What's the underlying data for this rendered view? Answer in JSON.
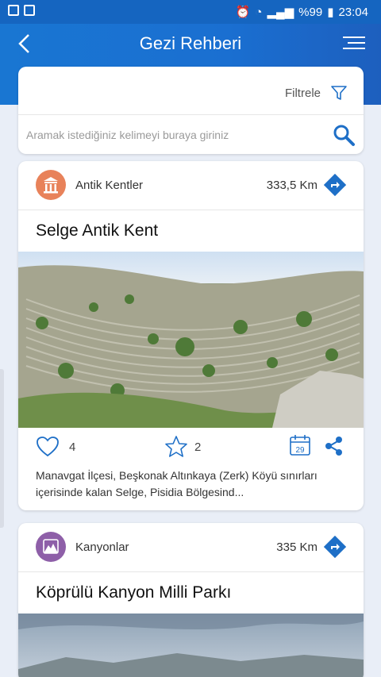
{
  "status_bar": {
    "battery": "%99",
    "time": "23:04"
  },
  "app_bar": {
    "title": "Gezi Rehberi",
    "back_icon": "back-arrow-icon",
    "menu_icon": "menu-icon"
  },
  "search": {
    "filter_label": "Filtrele",
    "placeholder": "Aramak istediğiniz kelimeyi buraya giriniz",
    "value": ""
  },
  "places": [
    {
      "category": "Antik Kentler",
      "category_icon": "ancient-temple-icon",
      "category_color": "#e8825a",
      "distance": "333,5 Km",
      "title": "Selge Antik Kent",
      "likes": "4",
      "stars": "2",
      "calendar_day": "29",
      "description": "Manavgat İlçesi, Beşkonak Altınkaya (Zerk) Köyü sınırları içerisinde kalan Selge, Pisidia Bölgesind..."
    },
    {
      "category": "Kanyonlar",
      "category_icon": "canyon-mountain-icon",
      "category_color": "#8e5fa8",
      "distance": "335 Km",
      "title": "Köprülü Kanyon Milli Parkı"
    }
  ],
  "colors": {
    "primary": "#1565c0",
    "accent": "#1e6fc7",
    "background": "#e9eef7"
  }
}
